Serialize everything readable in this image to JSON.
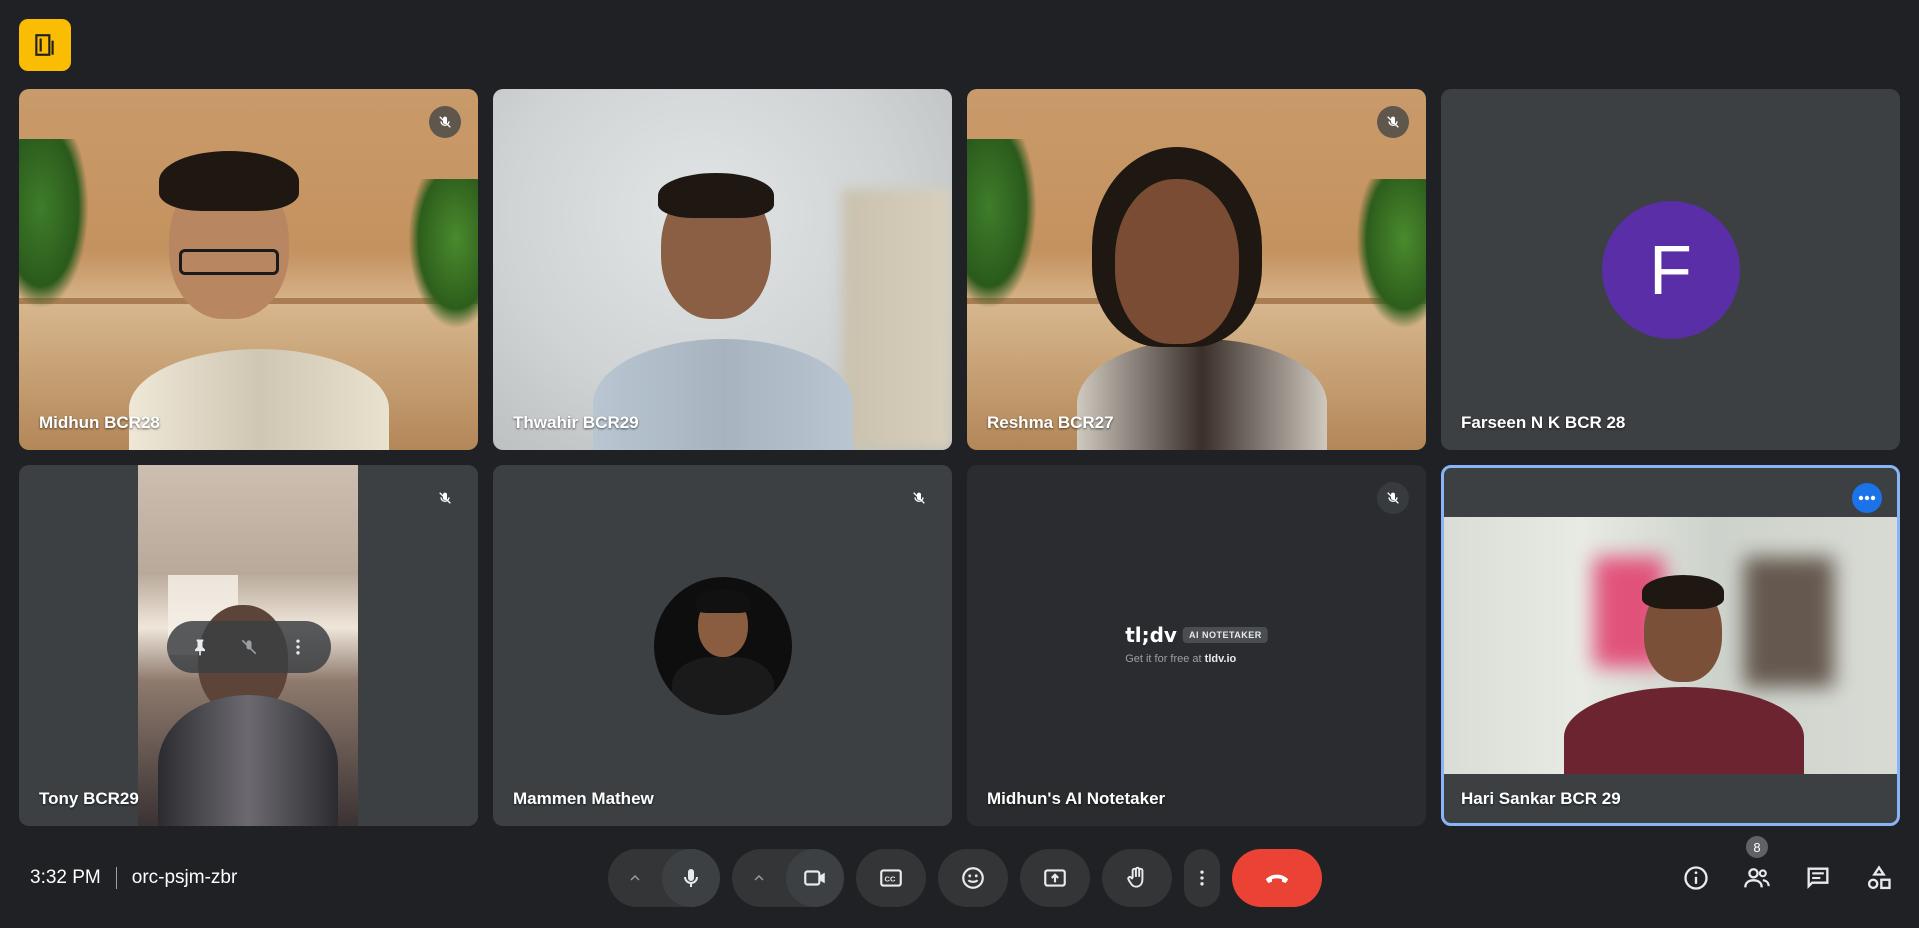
{
  "meeting": {
    "time": "3:32 PM",
    "code": "orc-psjm-zbr"
  },
  "participants": [
    {
      "name": "Midhun BCR28",
      "muted": true
    },
    {
      "name": "Thwahir BCR29",
      "muted": false
    },
    {
      "name": "Reshma BCR27",
      "muted": true
    },
    {
      "name": "Farseen N K BCR 28",
      "muted": false,
      "avatar_letter": "F",
      "avatar_color": "#5a2ea6"
    },
    {
      "name": "Tony BCR29",
      "muted": true
    },
    {
      "name": "Mammen Mathew",
      "muted": true
    },
    {
      "name": "Midhun's AI Notetaker",
      "muted": true
    },
    {
      "name": "Hari Sankar BCR 29",
      "muted": false,
      "active_speaker": true
    }
  ],
  "notetaker_card": {
    "logo": "tl;dv",
    "tag": "AI NOTETAKER",
    "sub_prefix": "Get it for free at",
    "sub_link": "tldv.io"
  },
  "controls": {
    "mic_icon": "mic-icon",
    "camera_icon": "videocam-icon",
    "captions_icon": "closed-captions-icon",
    "emoji_icon": "emoji-icon",
    "present_icon": "present-screen-icon",
    "hand_icon": "raise-hand-icon",
    "more_icon": "more-vert-icon",
    "leave_icon": "call-end-icon"
  },
  "side_panel": {
    "people_count": "8"
  },
  "colors": {
    "background": "#202124",
    "tile": "#3c4043",
    "leave_red": "#ea4335",
    "active_border": "#8ab4f8",
    "logo_badge": "#fbbc04"
  }
}
